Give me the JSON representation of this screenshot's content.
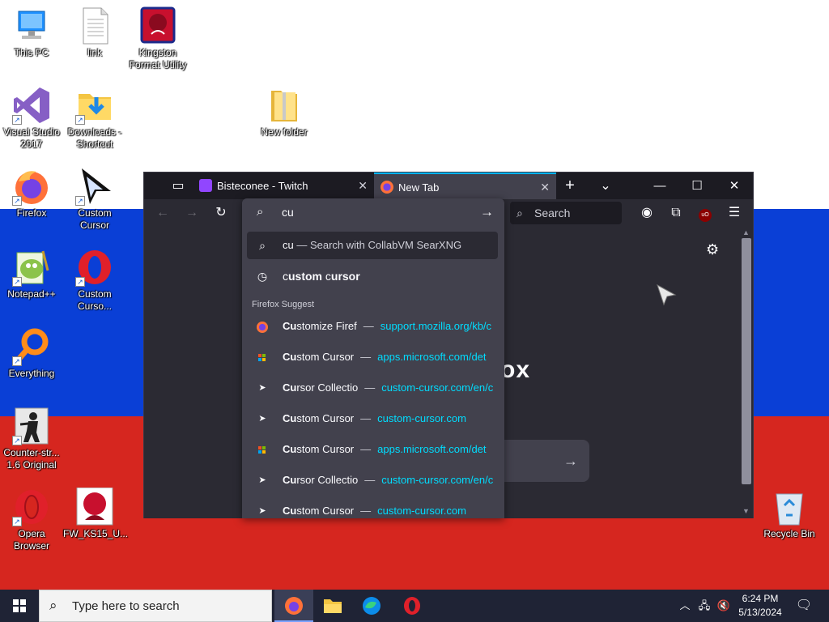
{
  "desktop": {
    "icons": [
      {
        "label": "This PC"
      },
      {
        "label": "link"
      },
      {
        "label": "Kingston Format Utility"
      },
      {
        "label": "Visual Studio 2017"
      },
      {
        "label": "Downloads - Shortcut"
      },
      {
        "label": "New folder"
      },
      {
        "label": "Firefox"
      },
      {
        "label": "Custom Cursor"
      },
      {
        "label": "Notepad++"
      },
      {
        "label": "Custom Curso..."
      },
      {
        "label": "Everything"
      },
      {
        "label": "Counter-str... 1.6 Original"
      },
      {
        "label": "Opera Browser"
      },
      {
        "label": "FW_KS15_U..."
      },
      {
        "label": "Recycle Bin"
      }
    ]
  },
  "browser": {
    "tabs": [
      {
        "label": "Bisteconee - Twitch",
        "active": false
      },
      {
        "label": "New Tab",
        "active": true
      }
    ],
    "search_placeholder": "Search",
    "brand_fragment": "ox",
    "urlbar": {
      "value": "cu",
      "heuristic": {
        "prefix": "cu",
        "suffix": " — Search with CollabVM SearXNG"
      },
      "history": {
        "bold": "c",
        "rest1": "ustom ",
        "bold2": "c",
        "rest2": "ursor",
        "full": "custom cursor"
      },
      "group_label": "Firefox Suggest",
      "results": [
        {
          "bold": "Cu",
          "rest": "stomize Firef",
          "url": "support.mozilla.org/kb/c",
          "icon": "firefox-icon"
        },
        {
          "bold": "Cu",
          "rest": "stom Cursor",
          "url": "apps.microsoft.com/det",
          "icon": "microsoft-store-icon"
        },
        {
          "bold": "Cu",
          "rest": "rsor Collectio",
          "url": "custom-cursor.com/en/c",
          "icon": "cursor-icon"
        },
        {
          "bold": "Cu",
          "rest": "stom Cursor",
          "url": "custom-cursor.com",
          "icon": "cursor-icon"
        },
        {
          "bold": "Cu",
          "rest": "stom Cursor",
          "url": "apps.microsoft.com/det",
          "icon": "microsoft-store-icon"
        },
        {
          "bold": "Cu",
          "rest": "rsor Collectio",
          "url": "custom-cursor.com/en/c",
          "icon": "cursor-icon"
        },
        {
          "bold": "Cu",
          "rest": "stom Cursor",
          "url": "custom-cursor.com",
          "icon": "cursor-icon"
        }
      ],
      "separator": "—"
    }
  },
  "taskbar": {
    "search_placeholder": "Type here to search",
    "time": "6:24 PM",
    "date": "5/13/2024"
  },
  "colors": {
    "flag_white": "#ffffff",
    "flag_blue": "#0a3fd6",
    "flag_red": "#d6261f",
    "accent": "#00b3f4",
    "url_link": "#00ddff"
  }
}
